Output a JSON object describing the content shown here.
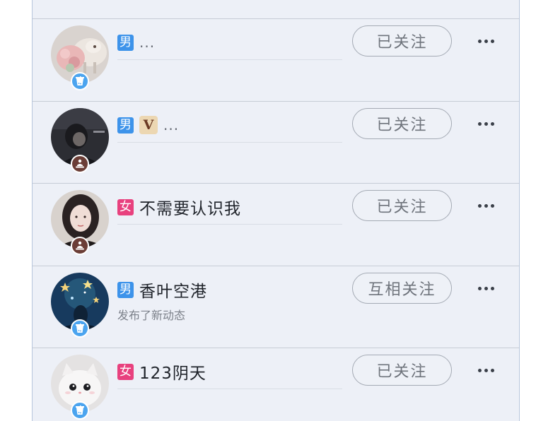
{
  "rows": [
    {
      "gender": "男",
      "gender_type": "male",
      "vip": "",
      "nickname": "...",
      "status": "",
      "follow_label": "已关注",
      "badge_icon": "milk-tea-icon"
    },
    {
      "gender": "男",
      "gender_type": "male",
      "vip": "V",
      "nickname": "...",
      "status": "",
      "follow_label": "已关注",
      "badge_icon": "meditation-person-icon"
    },
    {
      "gender": "女",
      "gender_type": "female",
      "vip": "",
      "nickname": "不需要认识我",
      "status": "",
      "follow_label": "已关注",
      "badge_icon": "meditation-person-icon"
    },
    {
      "gender": "男",
      "gender_type": "male",
      "vip": "",
      "nickname": "香叶空港",
      "status": "发布了新动态",
      "follow_label": "互相关注",
      "badge_icon": "milk-tea-icon"
    },
    {
      "gender": "女",
      "gender_type": "female",
      "vip": "",
      "nickname": "123阴天",
      "status": "",
      "follow_label": "已关注",
      "badge_icon": "milk-tea-icon"
    }
  ],
  "colors": {
    "male": "#3d93ea",
    "female": "#e8417e",
    "background": "#edf0f7",
    "button_border": "#a4aab4"
  }
}
